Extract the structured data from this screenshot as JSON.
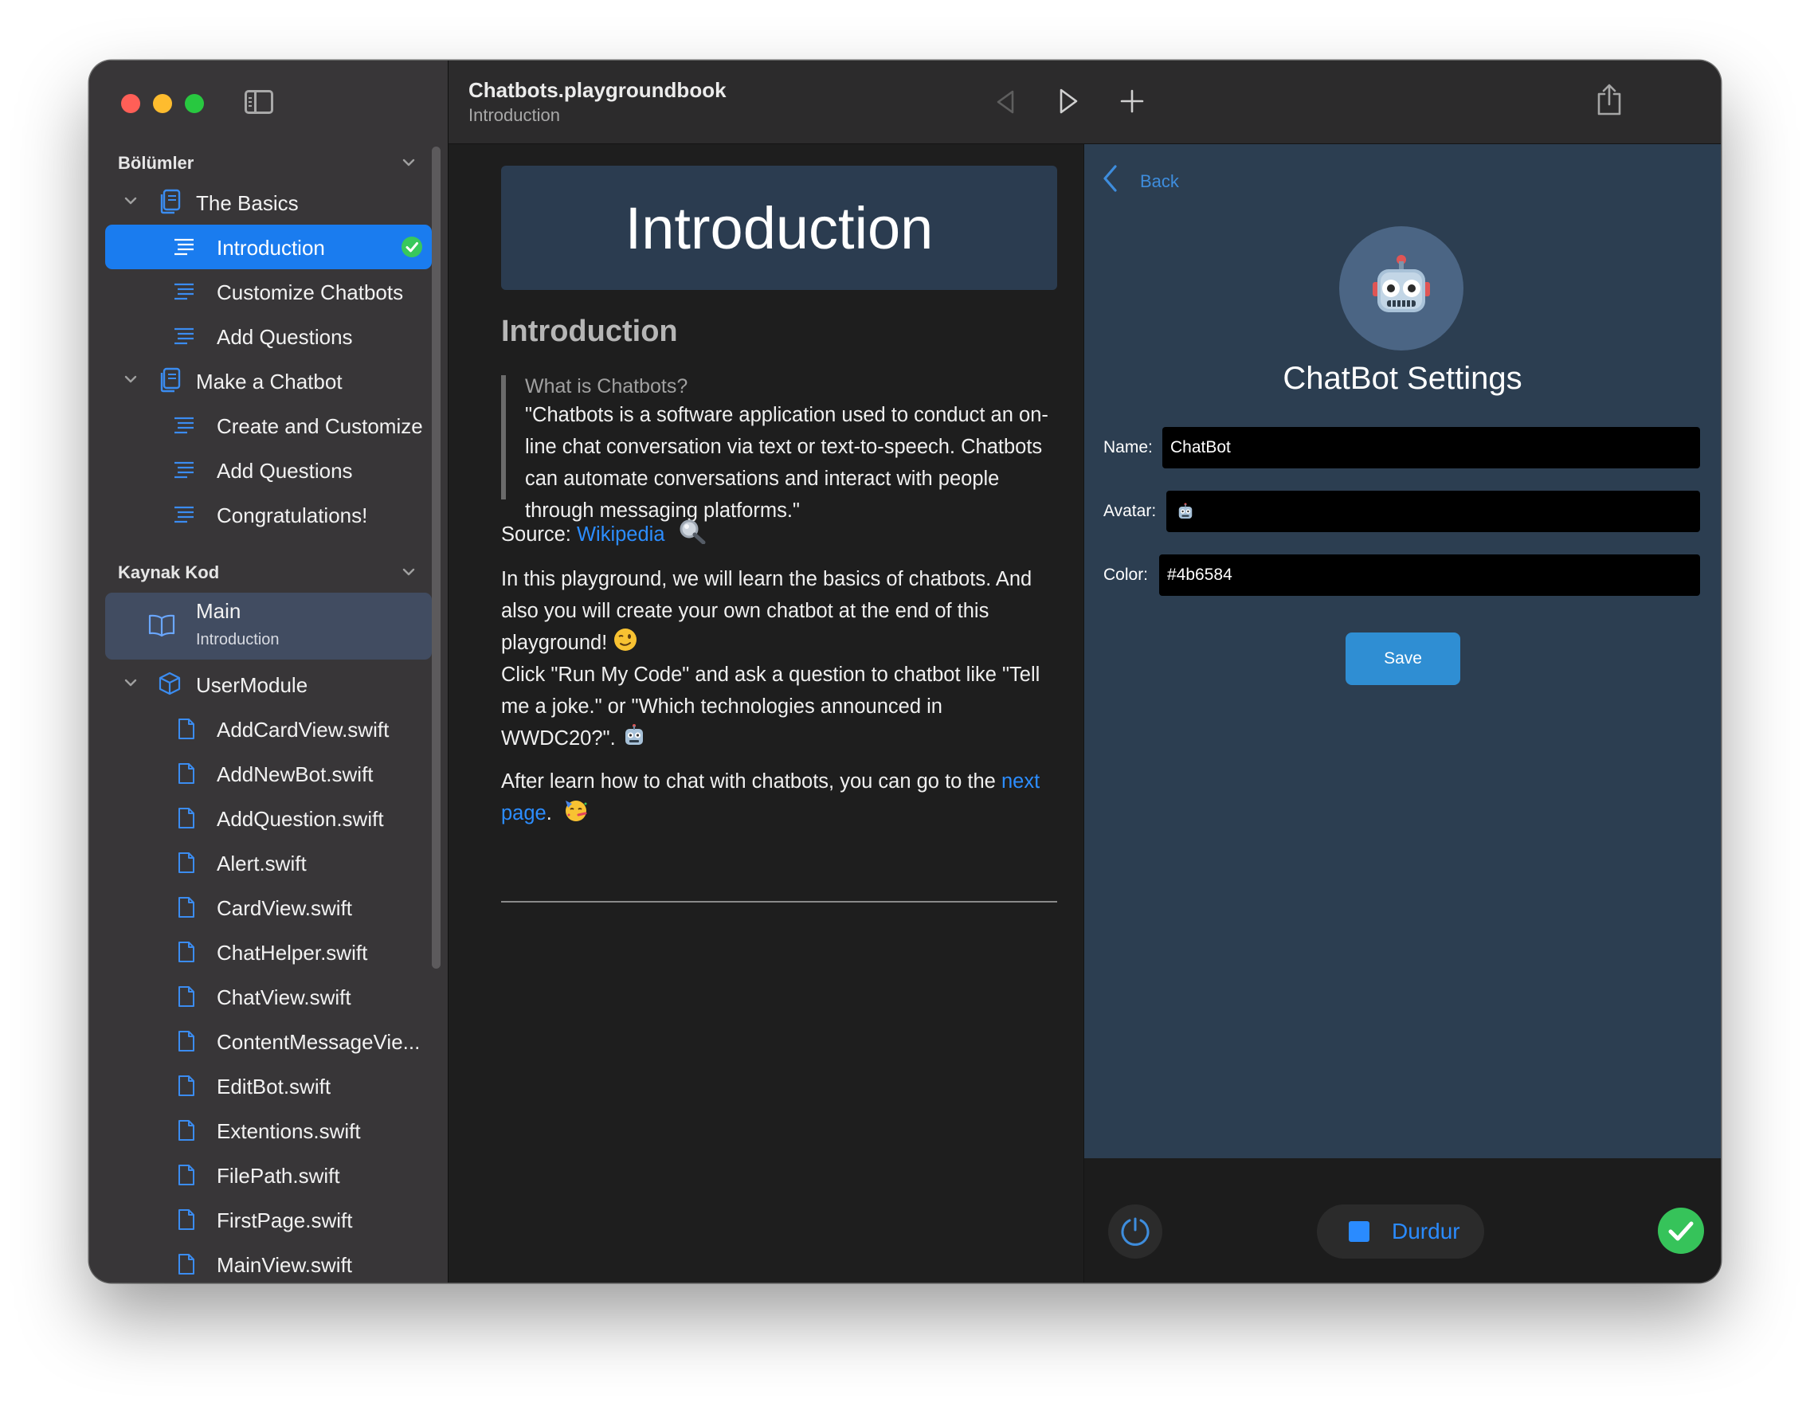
{
  "window": {
    "traffic_colors": [
      "#ff5f57",
      "#febc2e",
      "#28c840"
    ]
  },
  "sidebar": {
    "sections_label": "Bölümler",
    "chapters": [
      {
        "title": "The Basics",
        "pages": [
          "Introduction",
          "Customize Chatbots",
          "Add Questions"
        ]
      },
      {
        "title": "Make a Chatbot",
        "pages": [
          "Create and Customize",
          "Add Questions",
          "Congratulations!"
        ]
      }
    ],
    "source_label": "Kaynak Kod",
    "main": {
      "title": "Main",
      "subtitle": "Introduction"
    },
    "module": {
      "title": "UserModule",
      "files": [
        "AddCardView.swift",
        "AddNewBot.swift",
        "AddQuestion.swift",
        "Alert.swift",
        "CardView.swift",
        "ChatHelper.swift",
        "ChatView.swift",
        "ContentMessageVie...",
        "EditBot.swift",
        "Extentions.swift",
        "FilePath.swift",
        "FirstPage.swift",
        "MainView.swift"
      ]
    },
    "selected_page": "Introduction"
  },
  "toolbar": {
    "title": "Chatbots.playgroundbook",
    "subtitle": "Introduction",
    "icons": [
      "back-triangle-icon",
      "run-icon",
      "plus-icon",
      "share-icon"
    ]
  },
  "content": {
    "banner_title": "Introduction",
    "heading": "Introduction",
    "quote_title": "What is Chatbots?",
    "quote_body": "\"Chatbots is a software application used to conduct an on-line chat conversation via text or text-to-speech. Chatbots can automate conversations and interact with people through messaging platforms.\"",
    "source_prefix": "Source: ",
    "source_link": "Wikipedia",
    "para1": "In this playground, we will learn the basics of chatbots. And also you will create your own chatbot at the end of this playground!",
    "para2": "Click \"Run My Code\" and ask a question to chatbot like \"Tell me a joke.\" or \"Which technologies announced in WWDC20?\".",
    "para3_prefix": "After learn how to chat with chatbots, you can go to the ",
    "para3_link": "next page",
    "para3_suffix": ".",
    "link_color": "#2c8dff"
  },
  "live_view": {
    "back_label": "Back",
    "title": "ChatBot Settings",
    "fields": {
      "name_label": "Name:",
      "name_value": "ChatBot",
      "avatar_label": "Avatar:",
      "color_label": "Color:",
      "color_value": "#4b6584"
    },
    "save_label": "Save",
    "bg_color": "#2c3e51"
  },
  "bottom_bar": {
    "stop_label": "Durdur"
  }
}
